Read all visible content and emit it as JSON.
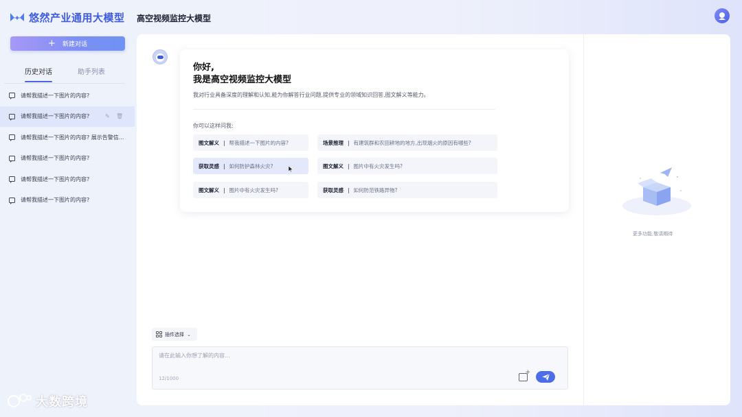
{
  "app": {
    "name": "悠然产业通用大模型",
    "page_title": "高空视频监控大模型",
    "brand_color": "#3f5be0"
  },
  "sidebar": {
    "new_chat_label": "新建对话",
    "tabs": [
      {
        "label": "历史对话",
        "active": true
      },
      {
        "label": "助手列表",
        "active": false
      }
    ],
    "history": [
      {
        "text": "请帮我描述一下图片的内容?",
        "active": false
      },
      {
        "text": "请帮我描述一下图片的内容?",
        "active": true
      },
      {
        "text": "请帮我描述一下图片的内容? 展示告警信...",
        "active": false
      },
      {
        "text": "请帮我描述一下图片的内容?",
        "active": false
      },
      {
        "text": "请帮我描述一下图片的内容?",
        "active": false
      },
      {
        "text": "请帮我描述一下图片的内容?",
        "active": false
      }
    ]
  },
  "welcome": {
    "hello": "你好,",
    "title": "我是高空视频监控大模型",
    "description": "我对行业具备深度的理解和认知,能为你解答行业问题,提供专业的领域知识回答,图文解义等能力。",
    "ask_prompt": "你可以这样问我:",
    "suggestions": [
      {
        "category": "图文解义",
        "text": "帮我描述一下图片的内容?"
      },
      {
        "category": "场景推理",
        "text": "有建筑群和农田耕地的地方,出现烟火的原因有哪些?"
      },
      {
        "category": "获取灵感",
        "text": "如何防护森林火灾?"
      },
      {
        "category": "图文解义",
        "text": "图片中有火灾发生吗?"
      },
      {
        "category": "图文解义",
        "text": "图片中有火灾发生吗?"
      },
      {
        "category": "获取灵感",
        "text": "如何防范铁路异物?"
      }
    ]
  },
  "composer": {
    "plugin_label": "插件选择",
    "placeholder": "请在此输入你想了解的内容...",
    "char_count": "12/1000"
  },
  "right_panel": {
    "empty_text": "更多功能,敬请期待"
  },
  "watermark": {
    "text": "大数跨境"
  }
}
